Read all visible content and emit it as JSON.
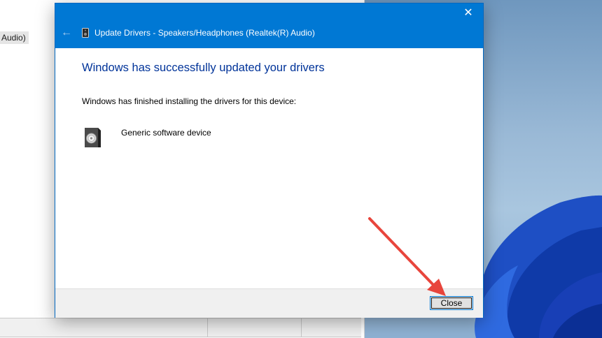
{
  "background_window": {
    "partial_text": "Audio)"
  },
  "dialog": {
    "title": "Update Drivers - Speakers/Headphones (Realtek(R) Audio)",
    "close_glyph": "✕",
    "back_glyph": "←",
    "heading": "Windows has successfully updated your drivers",
    "subtext": "Windows has finished installing the drivers for this device:",
    "device_name": "Generic software device",
    "close_button_label": "Close"
  },
  "icons": {
    "title_icon": "speaker-device-icon",
    "device_icon": "speaker-icon",
    "window_close": "close-icon",
    "back": "back-arrow-icon"
  },
  "colors": {
    "titlebar": "#0078d4",
    "heading": "#003399",
    "annotation_arrow": "#e8453c"
  }
}
